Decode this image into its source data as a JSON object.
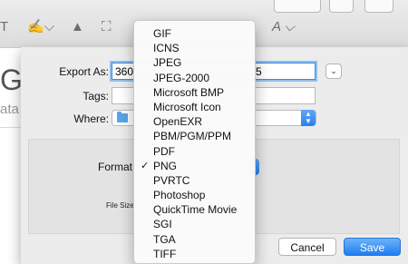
{
  "background": {
    "toolbar_tools": [
      "T",
      "✍⌵",
      "▲",
      "⛶",
      "A ⌵"
    ],
    "heading": "Gu",
    "subheading": "ata"
  },
  "dialog": {
    "export_as_label": "Export As:",
    "export_as_value": "360",
    "export_as_suffix": "5",
    "tags_label": "Tags:",
    "tags_value": "",
    "where_label": "Where:",
    "format_label": "Format",
    "file_size_label": "File Size",
    "cancel_label": "Cancel",
    "save_label": "Save"
  },
  "format_menu": {
    "selected": "PNG",
    "check_mark": "✓",
    "items": [
      "GIF",
      "ICNS",
      "JPEG",
      "JPEG-2000",
      "Microsoft BMP",
      "Microsoft Icon",
      "OpenEXR",
      "PBM/PGM/PPM",
      "PDF",
      "PNG",
      "PVRTC",
      "Photoshop",
      "QuickTime Movie",
      "SGI",
      "TGA",
      "TIFF"
    ]
  },
  "colors": {
    "accent": "#2a7ef0",
    "focus_ring": "#8fbff0"
  }
}
